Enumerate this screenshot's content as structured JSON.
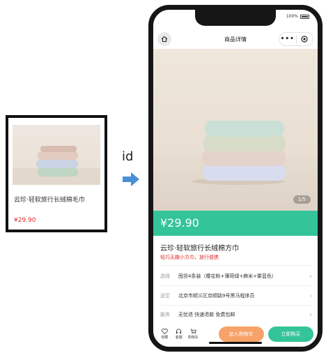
{
  "card": {
    "title": "云珍·轻软旅行长绒棉毛巾",
    "price": "¥29.90"
  },
  "arrow": {
    "label": "id"
  },
  "phone": {
    "status": {
      "battery_percent": "100%"
    },
    "nav": {
      "title": "商品详情",
      "more": "•••"
    },
    "gallery": {
      "pager": "1/5"
    },
    "product": {
      "price": "¥29.90",
      "title": "云珍·轻软旅行长绒棉方巾",
      "subtitle": "轻巧无趣小方巾，旅行便携"
    },
    "rows": [
      {
        "key": "选择",
        "value": "囤货4条装（樱花粉+薄荷绿+麻米+雾蓝色）"
      },
      {
        "key": "送至",
        "value": "北京市顺义区京顺路9号黑马程序员"
      },
      {
        "key": "服务",
        "value": "无忧退 快速退款 免费包邮"
      }
    ],
    "bottom": {
      "favorite": "收藏",
      "service": "客服",
      "cart": "购物车",
      "add_to_cart": "加入购物车",
      "buy_now": "立即购买"
    }
  },
  "colors": {
    "accent_green": "#34c49a",
    "accent_orange": "#f6a268",
    "price_red": "#e02a2a"
  }
}
